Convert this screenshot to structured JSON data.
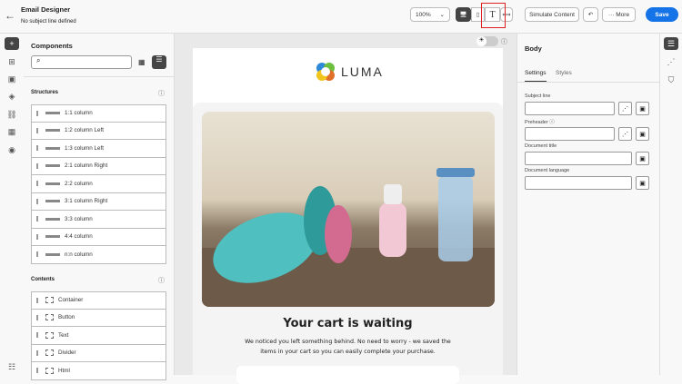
{
  "header": {
    "title": "Email Designer",
    "subtitle": "No subject line defined",
    "zoom": "100%",
    "simulate": "Simulate Content",
    "more": "More",
    "save": "Save"
  },
  "components": {
    "title": "Components",
    "search_placeholder": "",
    "structures_title": "Structures",
    "structures": [
      "1:1 column",
      "1:2 column Left",
      "1:3 column Left",
      "2:1 column Right",
      "2:2 column",
      "3:1 column Right",
      "3:3 column",
      "4:4 column",
      "n:n column"
    ],
    "contents_title": "Contents",
    "contents": [
      "Container",
      "Button",
      "Text",
      "Divider",
      "Html"
    ]
  },
  "email": {
    "logo": "LUMA",
    "headline": "Your cart is waiting",
    "body": "We noticed you left something behind. No need to worry - we saved the items in your cart so you can easily complete your purchase."
  },
  "panel": {
    "title": "Body",
    "tabs": [
      "Settings",
      "Styles"
    ],
    "fields": [
      {
        "label": "Subject line",
        "value": ""
      },
      {
        "label": "Preheader",
        "value": ""
      },
      {
        "label": "Document title",
        "value": ""
      },
      {
        "label": "Document language",
        "value": ""
      }
    ]
  },
  "colors": {
    "accent": "#1473e6",
    "highlight": "#e02020"
  }
}
